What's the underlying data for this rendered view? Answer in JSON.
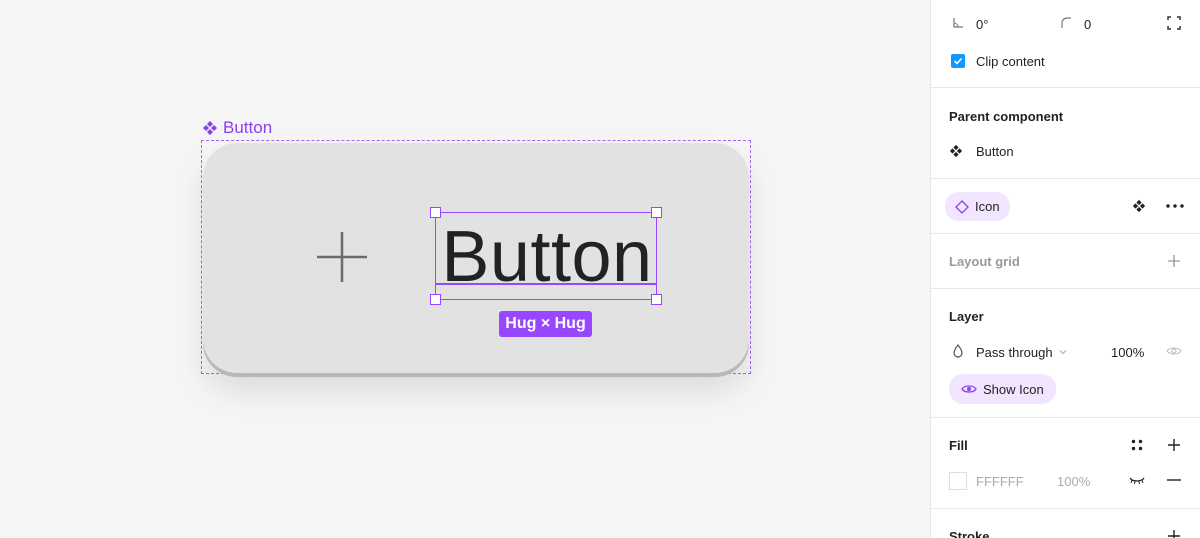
{
  "canvas": {
    "frame_label": "Button",
    "button_text": "Button",
    "hug_badge": "Hug × Hug"
  },
  "panel": {
    "rotation": "0°",
    "corner_radius": "0",
    "clip_content": "Clip content",
    "clip_checked": true,
    "parent_component_title": "Parent component",
    "parent_component_name": "Button",
    "icon_chip_label": "Icon",
    "layout_grid_title": "Layout grid",
    "layer_title": "Layer",
    "blend_mode": "Pass through",
    "layer_opacity": "100%",
    "show_icon_chip": "Show Icon",
    "fill_title": "Fill",
    "fill_hex": "FFFFFF",
    "fill_opacity": "100%",
    "stroke_title": "Stroke"
  },
  "colors": {
    "accent": "#9747ff",
    "checkbox": "#0d99ff",
    "chip_bg": "#f1e5ff"
  }
}
